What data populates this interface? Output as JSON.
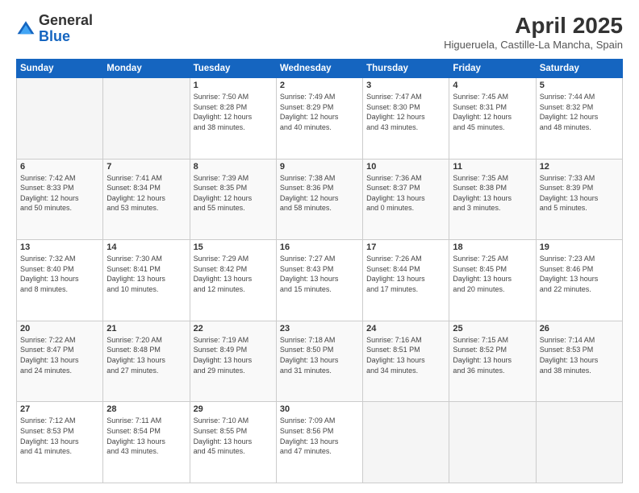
{
  "logo": {
    "general": "General",
    "blue": "Blue"
  },
  "title": "April 2025",
  "location": "Higueruela, Castille-La Mancha, Spain",
  "headers": [
    "Sunday",
    "Monday",
    "Tuesday",
    "Wednesday",
    "Thursday",
    "Friday",
    "Saturday"
  ],
  "weeks": [
    [
      {
        "day": "",
        "info": ""
      },
      {
        "day": "",
        "info": ""
      },
      {
        "day": "1",
        "info": "Sunrise: 7:50 AM\nSunset: 8:28 PM\nDaylight: 12 hours\nand 38 minutes."
      },
      {
        "day": "2",
        "info": "Sunrise: 7:49 AM\nSunset: 8:29 PM\nDaylight: 12 hours\nand 40 minutes."
      },
      {
        "day": "3",
        "info": "Sunrise: 7:47 AM\nSunset: 8:30 PM\nDaylight: 12 hours\nand 43 minutes."
      },
      {
        "day": "4",
        "info": "Sunrise: 7:45 AM\nSunset: 8:31 PM\nDaylight: 12 hours\nand 45 minutes."
      },
      {
        "day": "5",
        "info": "Sunrise: 7:44 AM\nSunset: 8:32 PM\nDaylight: 12 hours\nand 48 minutes."
      }
    ],
    [
      {
        "day": "6",
        "info": "Sunrise: 7:42 AM\nSunset: 8:33 PM\nDaylight: 12 hours\nand 50 minutes."
      },
      {
        "day": "7",
        "info": "Sunrise: 7:41 AM\nSunset: 8:34 PM\nDaylight: 12 hours\nand 53 minutes."
      },
      {
        "day": "8",
        "info": "Sunrise: 7:39 AM\nSunset: 8:35 PM\nDaylight: 12 hours\nand 55 minutes."
      },
      {
        "day": "9",
        "info": "Sunrise: 7:38 AM\nSunset: 8:36 PM\nDaylight: 12 hours\nand 58 minutes."
      },
      {
        "day": "10",
        "info": "Sunrise: 7:36 AM\nSunset: 8:37 PM\nDaylight: 13 hours\nand 0 minutes."
      },
      {
        "day": "11",
        "info": "Sunrise: 7:35 AM\nSunset: 8:38 PM\nDaylight: 13 hours\nand 3 minutes."
      },
      {
        "day": "12",
        "info": "Sunrise: 7:33 AM\nSunset: 8:39 PM\nDaylight: 13 hours\nand 5 minutes."
      }
    ],
    [
      {
        "day": "13",
        "info": "Sunrise: 7:32 AM\nSunset: 8:40 PM\nDaylight: 13 hours\nand 8 minutes."
      },
      {
        "day": "14",
        "info": "Sunrise: 7:30 AM\nSunset: 8:41 PM\nDaylight: 13 hours\nand 10 minutes."
      },
      {
        "day": "15",
        "info": "Sunrise: 7:29 AM\nSunset: 8:42 PM\nDaylight: 13 hours\nand 12 minutes."
      },
      {
        "day": "16",
        "info": "Sunrise: 7:27 AM\nSunset: 8:43 PM\nDaylight: 13 hours\nand 15 minutes."
      },
      {
        "day": "17",
        "info": "Sunrise: 7:26 AM\nSunset: 8:44 PM\nDaylight: 13 hours\nand 17 minutes."
      },
      {
        "day": "18",
        "info": "Sunrise: 7:25 AM\nSunset: 8:45 PM\nDaylight: 13 hours\nand 20 minutes."
      },
      {
        "day": "19",
        "info": "Sunrise: 7:23 AM\nSunset: 8:46 PM\nDaylight: 13 hours\nand 22 minutes."
      }
    ],
    [
      {
        "day": "20",
        "info": "Sunrise: 7:22 AM\nSunset: 8:47 PM\nDaylight: 13 hours\nand 24 minutes."
      },
      {
        "day": "21",
        "info": "Sunrise: 7:20 AM\nSunset: 8:48 PM\nDaylight: 13 hours\nand 27 minutes."
      },
      {
        "day": "22",
        "info": "Sunrise: 7:19 AM\nSunset: 8:49 PM\nDaylight: 13 hours\nand 29 minutes."
      },
      {
        "day": "23",
        "info": "Sunrise: 7:18 AM\nSunset: 8:50 PM\nDaylight: 13 hours\nand 31 minutes."
      },
      {
        "day": "24",
        "info": "Sunrise: 7:16 AM\nSunset: 8:51 PM\nDaylight: 13 hours\nand 34 minutes."
      },
      {
        "day": "25",
        "info": "Sunrise: 7:15 AM\nSunset: 8:52 PM\nDaylight: 13 hours\nand 36 minutes."
      },
      {
        "day": "26",
        "info": "Sunrise: 7:14 AM\nSunset: 8:53 PM\nDaylight: 13 hours\nand 38 minutes."
      }
    ],
    [
      {
        "day": "27",
        "info": "Sunrise: 7:12 AM\nSunset: 8:53 PM\nDaylight: 13 hours\nand 41 minutes."
      },
      {
        "day": "28",
        "info": "Sunrise: 7:11 AM\nSunset: 8:54 PM\nDaylight: 13 hours\nand 43 minutes."
      },
      {
        "day": "29",
        "info": "Sunrise: 7:10 AM\nSunset: 8:55 PM\nDaylight: 13 hours\nand 45 minutes."
      },
      {
        "day": "30",
        "info": "Sunrise: 7:09 AM\nSunset: 8:56 PM\nDaylight: 13 hours\nand 47 minutes."
      },
      {
        "day": "",
        "info": ""
      },
      {
        "day": "",
        "info": ""
      },
      {
        "day": "",
        "info": ""
      }
    ]
  ]
}
